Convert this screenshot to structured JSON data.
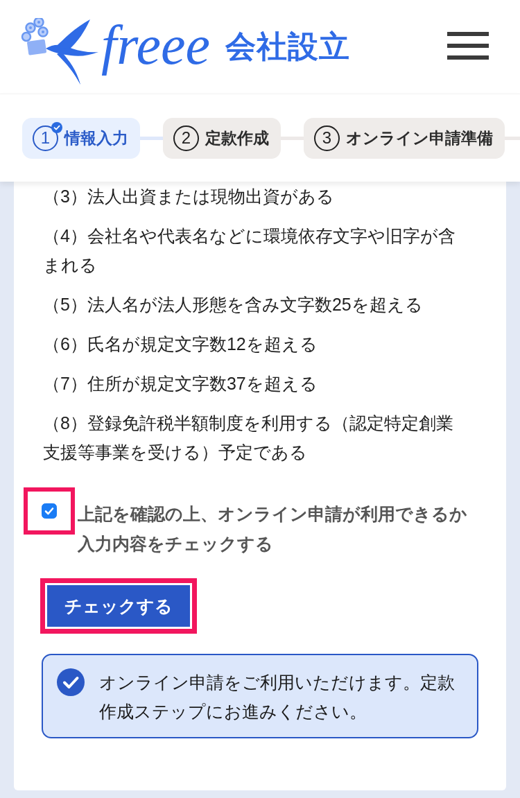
{
  "header": {
    "logo_text": "freee",
    "logo_subtitle": "会社設立"
  },
  "steps": [
    {
      "number": "1",
      "label": "情報入力",
      "selected": true,
      "completed": true
    },
    {
      "number": "2",
      "label": "定款作成",
      "selected": false,
      "completed": false
    },
    {
      "number": "3",
      "label": "オンライン申請準備",
      "selected": false,
      "completed": false
    }
  ],
  "conditions": [
    "（3）法人出資または現物出資がある",
    "（4）会社名や代表名などに環境依存文字や旧字が含まれる",
    "（5）法人名が法人形態を含み文字数25を超える",
    "（6）氏名が規定文字数12を超える",
    "（7）住所が規定文字数37を超える",
    "（8）登録免許税半額制度を利用する（認定特定創業支援等事業を受ける）予定である"
  ],
  "confirm": {
    "label": "上記を確認の上、オンライン申請が利用できるか入力内容をチェックする",
    "checked": true,
    "highlighted": true
  },
  "check_button": {
    "label": "チェックする",
    "highlighted": true
  },
  "result": {
    "text": "オンライン申請をご利用いただけます。定款作成ステップにお進みください。"
  }
}
